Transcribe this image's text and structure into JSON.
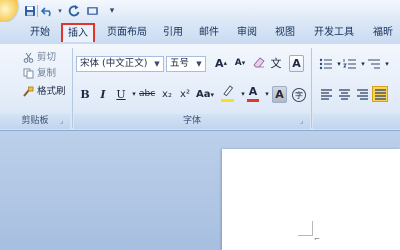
{
  "quick_access": {
    "icons": [
      "office-orb",
      "save-icon",
      "undo-icon",
      "redo-icon",
      "print-preview-icon",
      "customize-dropdown-icon"
    ],
    "dropdown_glyph": "▾"
  },
  "tabs": [
    {
      "label": "开始",
      "active": false
    },
    {
      "label": "插入",
      "active": true
    },
    {
      "label": "页面布局",
      "active": false
    },
    {
      "label": "引用",
      "active": false
    },
    {
      "label": "邮件",
      "active": false
    },
    {
      "label": "审阅",
      "active": false
    },
    {
      "label": "视图",
      "active": false
    },
    {
      "label": "开发工具",
      "active": false
    },
    {
      "label": "福昕",
      "active": false
    }
  ],
  "clipboard": {
    "cut_label": "剪切",
    "copy_label": "复制",
    "format_painter_label": "格式刷",
    "group_label": "剪贴板",
    "icons": [
      "scissors-icon",
      "copy-icon",
      "format-painter-icon"
    ]
  },
  "font": {
    "font_name": "宋体 (中文正文)",
    "font_size": "五号",
    "grow_label": "A",
    "shrink_label": "A",
    "phonetic_label": "文",
    "char_border_label": "A",
    "bold": "B",
    "italic": "I",
    "underline": "U",
    "strikethrough": "abc",
    "subscript": "x₂",
    "superscript": "x²",
    "change_case": "Aa",
    "highlight_label": "ab",
    "font_color_label": "A",
    "char_shading_label": "A",
    "enclose_label": "字",
    "group_label": "字体"
  },
  "colors": {
    "active_tab_border": "#e0362c",
    "highlight_bar": "#f7e21a",
    "font_color_bar": "#e0362c",
    "para_highlight": "#f7d35a"
  }
}
